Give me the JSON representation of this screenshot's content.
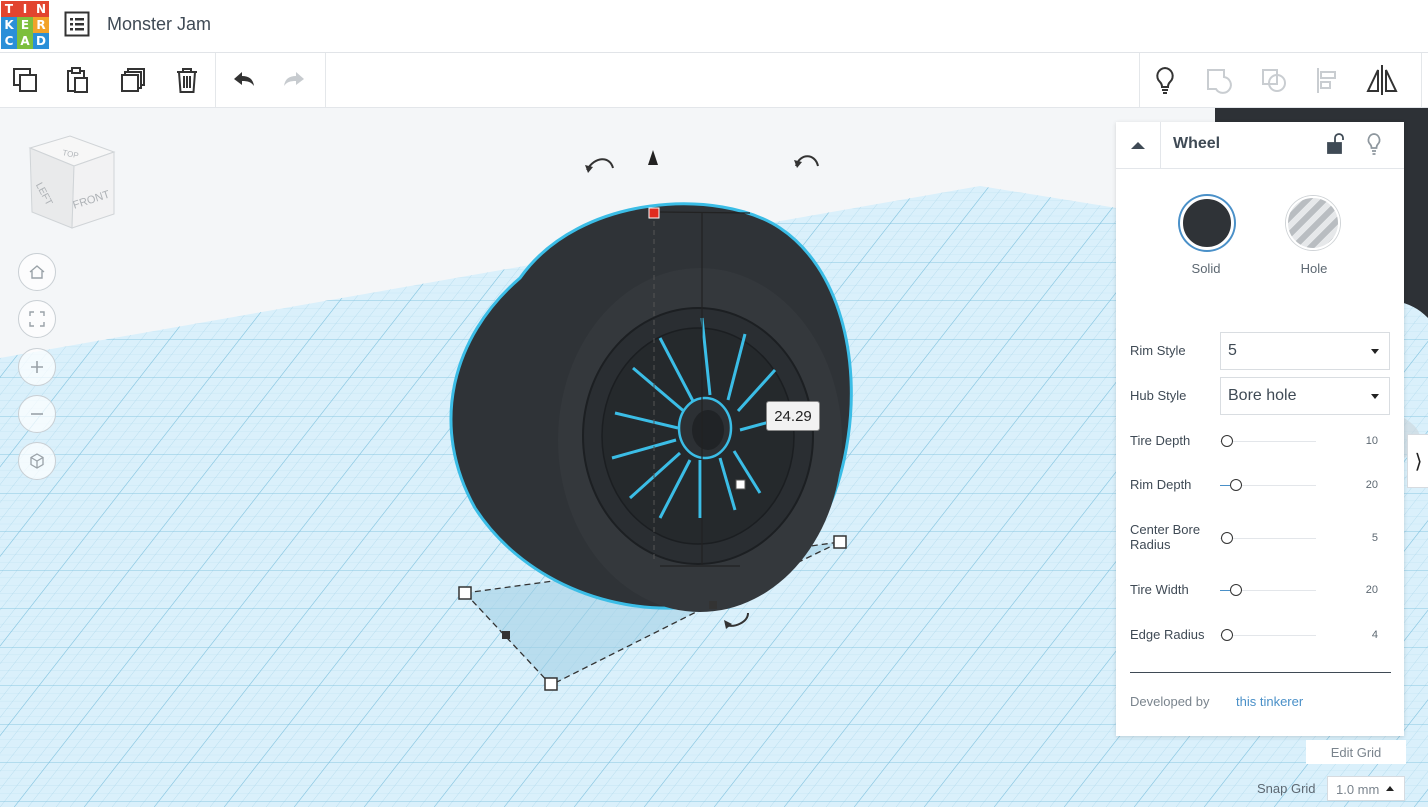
{
  "app": {
    "logo_letters": [
      "T",
      "I",
      "N",
      "K",
      "E",
      "R",
      "C",
      "A",
      "D"
    ],
    "logo_colors": [
      "#e2442f",
      "#e2442f",
      "#e2442f",
      "#2a8fd8",
      "#7dbf3d",
      "#f2a32a",
      "#2a8fd8",
      "#7dbf3d",
      "#2a8fd8"
    ],
    "project_title": "Monster Jam",
    "accent_color": "#4ec4e8"
  },
  "toolbar": {
    "left_icons": [
      "copy-icon",
      "paste-icon",
      "duplicate-icon",
      "trash-icon",
      "undo-icon",
      "redo-icon"
    ],
    "right_icons": [
      "lightbulb-icon",
      "group-icon",
      "ungroup-icon",
      "align-icon",
      "mirror-icon"
    ]
  },
  "view_cube": {
    "top": "TOP",
    "left": "LEFT",
    "front": "FRONT"
  },
  "nav_buttons": [
    "home-view-icon",
    "fit-view-icon",
    "zoom-in-icon",
    "zoom-out-icon",
    "perspective-icon"
  ],
  "canvas": {
    "dimension_value": "24.29"
  },
  "inspector": {
    "shape_name": "Wheel",
    "solid_label": "Solid",
    "hole_label": "Hole",
    "rim_style": {
      "label": "Rim Style",
      "value": "5"
    },
    "hub_style": {
      "label": "Hub Style",
      "value": "Bore hole"
    },
    "sliders": [
      {
        "label": "Tire Depth",
        "value": "10",
        "level": 0.0
      },
      {
        "label": "Rim Depth",
        "value": "20",
        "level": 0.1
      },
      {
        "label": "Center Bore Radius",
        "value": "5",
        "level": 0.0
      },
      {
        "label": "Tire Width",
        "value": "20",
        "level": 0.1
      },
      {
        "label": "Edge Radius",
        "value": "4",
        "level": 0.0
      }
    ],
    "developed_by": "Developed by",
    "developer_link": "this tinkerer"
  },
  "grid": {
    "edit_label": "Edit Grid",
    "snap_label": "Snap Grid",
    "snap_value": "1.0 mm"
  }
}
